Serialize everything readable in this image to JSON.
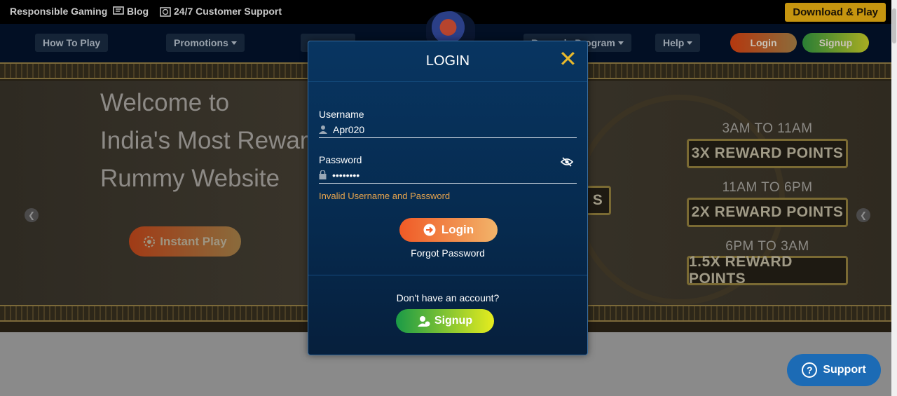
{
  "topbar": {
    "responsible": "Responsible Gaming",
    "blog": "Blog",
    "support": "24/7 Customer Support",
    "download": "Download & Play"
  },
  "nav": {
    "how_to_play": "How To Play",
    "promotions": "Promotions",
    "rewards_program": "Rewards Program",
    "help": "Help",
    "login": "Login",
    "signup": "Signup"
  },
  "hero": {
    "line1": "Welcome to",
    "line2": "India's Most Rewar",
    "line3": "Rummy Website",
    "instant_play": "Instant Play",
    "slot1_time": "3AM TO 11AM",
    "slot1_reward": "3X REWARD POINTS",
    "slot2_time": "11AM TO 6PM",
    "slot2_reward": "2X REWARD POINTS",
    "slot3_time": "6PM TO 3AM",
    "slot3_reward": "1.5X REWARD POINTS"
  },
  "modal": {
    "title": "LOGIN",
    "username_label": "Username",
    "username_value": "Apr020",
    "password_label": "Password",
    "password_value": "••••••••",
    "error": "Invalid Username and Password",
    "login_button": "Login",
    "forgot": "Forgot Password",
    "no_account": "Don't have an account?",
    "signup_button": "Signup"
  },
  "support_button": "Support"
}
